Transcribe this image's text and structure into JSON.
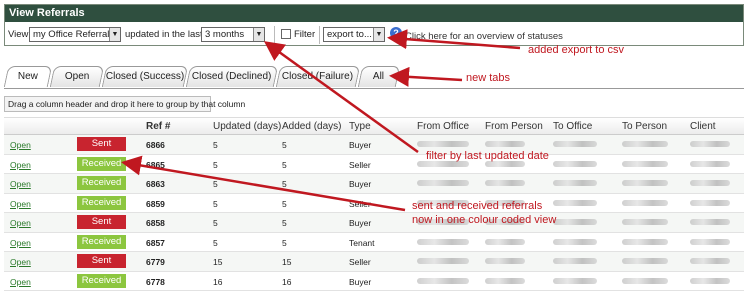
{
  "panel": {
    "title": "View Referrals",
    "view_label": "View",
    "view_select": "my Office Referrals",
    "updated_label": "updated in the last",
    "period_select": "3 months",
    "filter_label": "Filter",
    "export_select": "export to...",
    "help_text": "Click here for an overview of statuses"
  },
  "tabs": [
    {
      "label": "New",
      "active": true
    },
    {
      "label": "Open"
    },
    {
      "label": "Closed (Success)"
    },
    {
      "label": "Closed (Declined)"
    },
    {
      "label": "Closed (Failure)"
    },
    {
      "label": "All"
    }
  ],
  "group_bar": "Drag a column header and drop it here to group by that column",
  "grid": {
    "columns": [
      "",
      "",
      "Ref #",
      "Updated (days)",
      "Added (days)",
      "Type",
      "From Office",
      "From Person",
      "To Office",
      "To Person",
      "Client"
    ],
    "rows": [
      {
        "action": "Open",
        "status": "Sent",
        "ref": "6866",
        "updated": "5",
        "added": "5",
        "type": "Buyer"
      },
      {
        "action": "Open",
        "status": "Received",
        "ref": "6865",
        "updated": "5",
        "added": "5",
        "type": "Seller"
      },
      {
        "action": "Open",
        "status": "Received",
        "ref": "6863",
        "updated": "5",
        "added": "5",
        "type": "Buyer"
      },
      {
        "action": "Open",
        "status": "Received",
        "ref": "6859",
        "updated": "5",
        "added": "5",
        "type": "Seller"
      },
      {
        "action": "Open",
        "status": "Sent",
        "ref": "6858",
        "updated": "5",
        "added": "5",
        "type": "Buyer"
      },
      {
        "action": "Open",
        "status": "Received",
        "ref": "6857",
        "updated": "5",
        "added": "5",
        "type": "Tenant"
      },
      {
        "action": "Open",
        "status": "Sent",
        "ref": "6779",
        "updated": "15",
        "added": "15",
        "type": "Seller"
      },
      {
        "action": "Open",
        "status": "Received",
        "ref": "6778",
        "updated": "16",
        "added": "16",
        "type": "Buyer"
      }
    ]
  },
  "annotations": [
    {
      "text": "added export to csv"
    },
    {
      "text": "new tabs"
    },
    {
      "text": "filter by last updated date"
    },
    {
      "text": "sent and received referrals"
    },
    {
      "text": "now in one colour coded view"
    }
  ],
  "colors": {
    "sent": "#c8242f",
    "received": "#8cc63f",
    "annotation": "#c01820",
    "header": "#2f4f3f"
  }
}
